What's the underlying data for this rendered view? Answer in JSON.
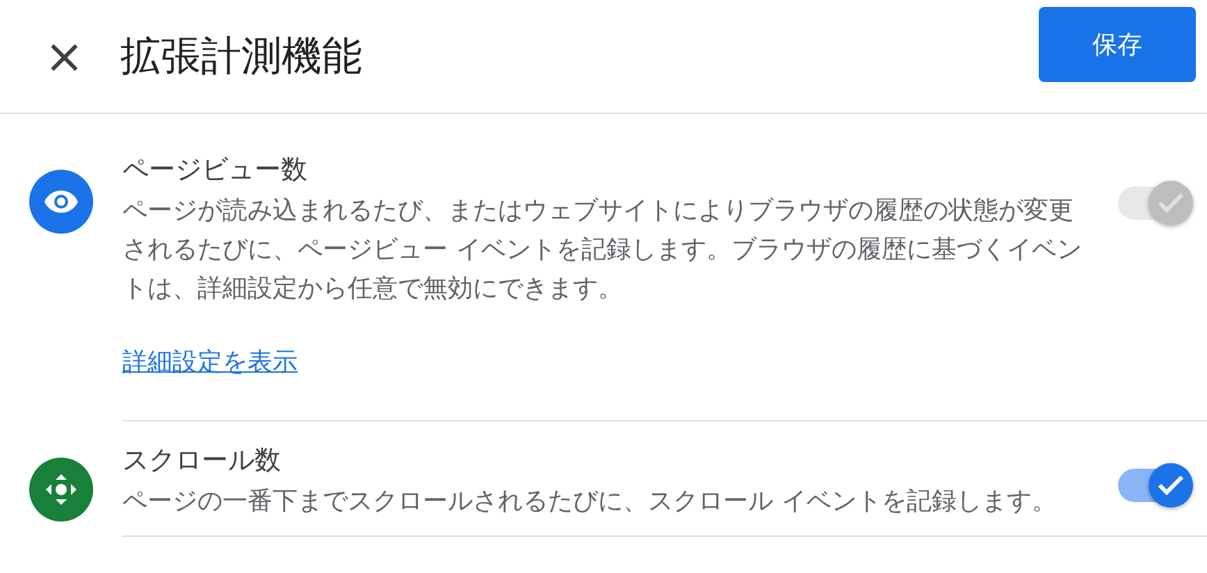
{
  "header": {
    "close": "×",
    "title": "拡張計測機能",
    "save_button": "保存"
  },
  "settings": [
    {
      "kind": "pageview",
      "title": "ページビュー数",
      "description": "ページが読み込まれるたび、またはウェブサイトによりブラウザの履歴の状態が変更されるたびに、ページビュー イベントを記録します。ブラウザの履歴に基づくイベントは、詳細設定から任意で無効にできます。",
      "link": "詳細設定を表示",
      "on": true,
      "disabled": true
    },
    {
      "kind": "scroll",
      "title": "スクロール数",
      "description": "ページの一番下までスクロールされるたびに、スクロール イベントを記録します。",
      "on": true,
      "disabled": false
    }
  ]
}
